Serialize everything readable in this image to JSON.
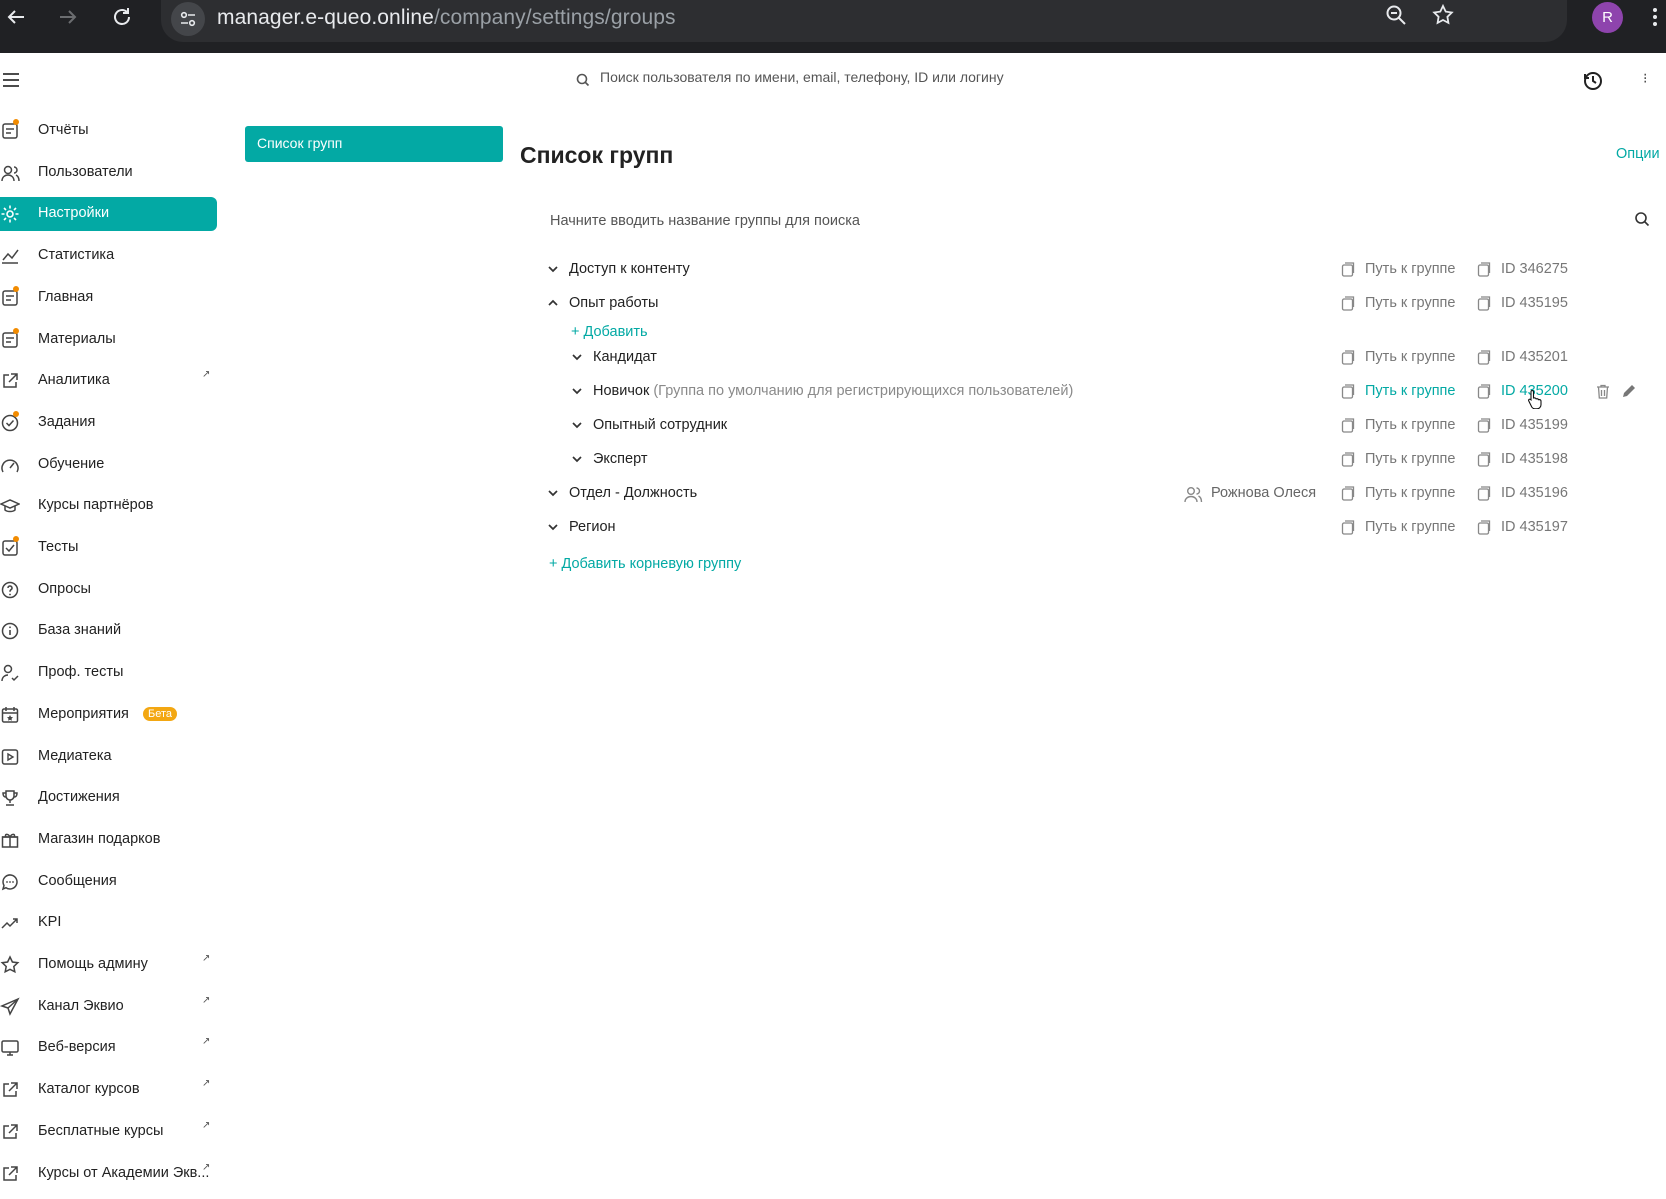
{
  "browser": {
    "url_host": "manager.e-queo.online",
    "url_path": "/company/settings/groups",
    "profile_initial": "R"
  },
  "header": {
    "search_placeholder": "Поиск пользователя по имени, email, телефону, ID или логину",
    "more_label": "⁝"
  },
  "sidebar": {
    "items": [
      {
        "label": "Отчёты",
        "icon": "report-icon"
      },
      {
        "label": "Пользователи",
        "icon": "users-icon"
      },
      {
        "label": "Настройки",
        "icon": "gear-icon",
        "active": true
      },
      {
        "label": "Статистика",
        "icon": "chart-icon"
      },
      {
        "label": "Главная",
        "icon": "home-icon"
      },
      {
        "label": "Материалы",
        "icon": "materials-icon"
      },
      {
        "label": "Аналитика",
        "icon": "external-link-icon",
        "external": true
      },
      {
        "label": "Задания",
        "icon": "task-icon"
      },
      {
        "label": "Обучение",
        "icon": "learning-icon"
      },
      {
        "label": "Курсы партнёров",
        "icon": "graduation-cap-icon"
      },
      {
        "label": "Тесты",
        "icon": "tests-icon"
      },
      {
        "label": "Опросы",
        "icon": "poll-icon"
      },
      {
        "label": "База знаний",
        "icon": "info-icon"
      },
      {
        "label": "Проф. тесты",
        "icon": "user-check-icon"
      },
      {
        "label": "Мероприятия",
        "icon": "calendar-icon",
        "badge": "Бета"
      },
      {
        "label": "Медиатека",
        "icon": "play-icon"
      },
      {
        "label": "Достижения",
        "icon": "trophy-icon"
      },
      {
        "label": "Магазин подарков",
        "icon": "gift-icon"
      },
      {
        "label": "Сообщения",
        "icon": "chat-icon"
      },
      {
        "label": "KPI",
        "icon": "trend-icon"
      },
      {
        "label": "Помощь админу",
        "icon": "star-icon",
        "external": true
      },
      {
        "label": "Канал Эквио",
        "icon": "send-icon",
        "external": true
      },
      {
        "label": "Веб-версия",
        "icon": "monitor-icon",
        "external": true
      },
      {
        "label": "Каталог курсов",
        "icon": "external-link-icon",
        "external": true
      },
      {
        "label": "Бесплатные курсы",
        "icon": "external-link-icon",
        "external": true
      },
      {
        "label": "Курсы от Академии Экв...",
        "icon": "external-link-icon",
        "external": true
      }
    ],
    "external_mark": "↗"
  },
  "panel": {
    "group_list_tab": "Список групп"
  },
  "main": {
    "title": "Список групп",
    "options": "Опции",
    "search_placeholder": "Начните вводить название группы для поиска",
    "path_label": "Путь к группе",
    "groups": [
      {
        "name": "Доступ к контенту",
        "id": "ID 346275",
        "level": 0,
        "expanded": false
      },
      {
        "name": "Опыт работы",
        "id": "ID 435195",
        "level": 0,
        "expanded": true
      },
      {
        "name": "Кандидат",
        "id": "ID 435201",
        "level": 1,
        "expanded": false
      },
      {
        "name": "Новичок",
        "note": " (Группа по умолчанию для регистрирующихся пользователей)",
        "id": "ID 435200",
        "level": 1,
        "expanded": false,
        "hovered": true
      },
      {
        "name": "Опытный сотрудник",
        "id": "ID 435199",
        "level": 1,
        "expanded": false
      },
      {
        "name": "Эксперт",
        "id": "ID 435198",
        "level": 1,
        "expanded": false
      },
      {
        "name": "Отдел - Должность",
        "id": "ID 435196",
        "level": 0,
        "expanded": false,
        "owner": "Рожнова Олеся"
      },
      {
        "name": "Регион",
        "id": "ID 435197",
        "level": 0,
        "expanded": false
      }
    ],
    "add_child": "+  Добавить",
    "add_root": "+  Добавить корневую группу"
  },
  "colors": {
    "accent": "#03a9a4",
    "badge": "#f3a712",
    "browser_bg": "#202124"
  }
}
